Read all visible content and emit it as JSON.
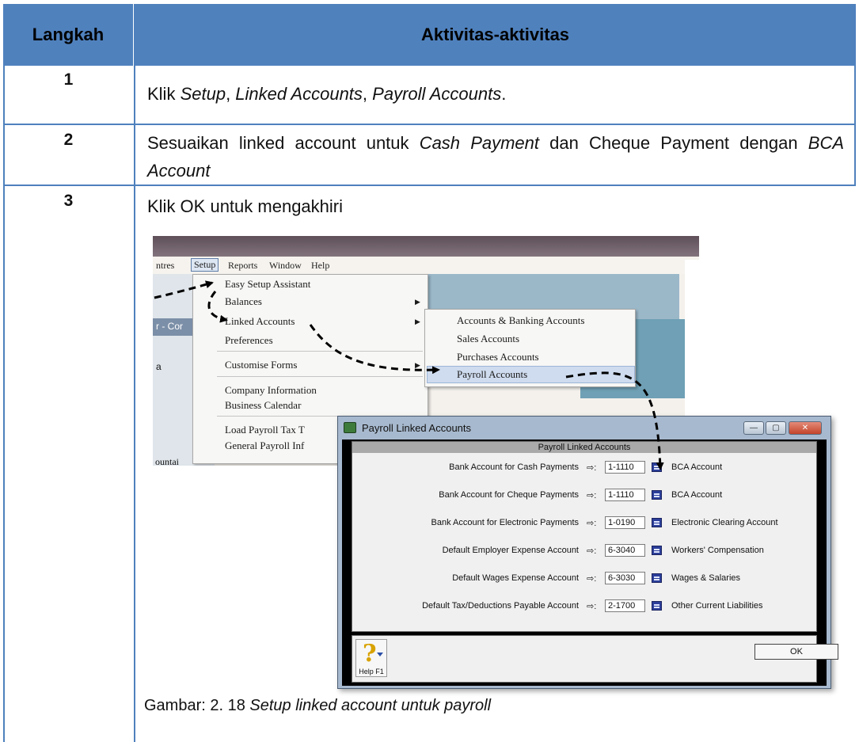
{
  "table": {
    "header": {
      "col1": "Langkah",
      "col2": "Aktivitas-aktivitas"
    },
    "rows": [
      {
        "step": "1",
        "text_parts": [
          "Klik ",
          "Setup",
          ", ",
          "Linked Accounts",
          ", ",
          "Payroll Accounts",
          "."
        ]
      },
      {
        "step": "2",
        "text_parts": [
          "Sesuaikan linked account untuk ",
          "Cash Payment",
          "  dan Cheque Payment dengan ",
          "BCA Account"
        ]
      },
      {
        "step": "3",
        "text": "Klik OK untuk mengakhiri"
      }
    ],
    "caption": {
      "prefix": "Gambar: 2. 18 ",
      "italic": "Setup linked account untuk payroll"
    }
  },
  "screenshot": {
    "menubar": [
      "ntres",
      "Setup",
      "Reports",
      "Window",
      "Help"
    ],
    "side_label": "r - Cor",
    "setup_menu": [
      "Easy Setup Assistant",
      "Balances",
      "Linked Accounts",
      "Preferences",
      "Customise Forms",
      "Company Information",
      "Business Calendar",
      "Load Payroll Tax T",
      "General Payroll Inf"
    ],
    "side_bottom": "ountai",
    "side_digit": "a",
    "linked_submenu": [
      "Accounts & Banking Accounts",
      "Sales Accounts",
      "Purchases Accounts",
      "Payroll Accounts"
    ]
  },
  "dialog": {
    "title": "Payroll Linked Accounts",
    "panel_header": "Payroll Linked Accounts",
    "window_buttons": {
      "min": "—",
      "max": "▢",
      "close": "✕"
    },
    "arrow": "⇨:",
    "fields": [
      {
        "label": "Bank Account for Cash Payments",
        "code": "1-1110",
        "name": "BCA Account"
      },
      {
        "label": "Bank Account for Cheque Payments",
        "code": "1-1110",
        "name": "BCA Account"
      },
      {
        "label": "Bank Account for Electronic Payments",
        "code": "1-0190",
        "name": "Electronic Clearing Account"
      },
      {
        "label": "Default Employer Expense Account",
        "code": "6-3040",
        "name": "Workers' Compensation"
      },
      {
        "label": "Default Wages Expense Account",
        "code": "6-3030",
        "name": "Wages & Salaries"
      },
      {
        "label": "Default Tax/Deductions Payable Account",
        "code": "2-1700",
        "name": "Other Current Liabilities"
      }
    ],
    "help_label": "Help F1",
    "help_glyph": "?",
    "ok_label": "OK"
  }
}
